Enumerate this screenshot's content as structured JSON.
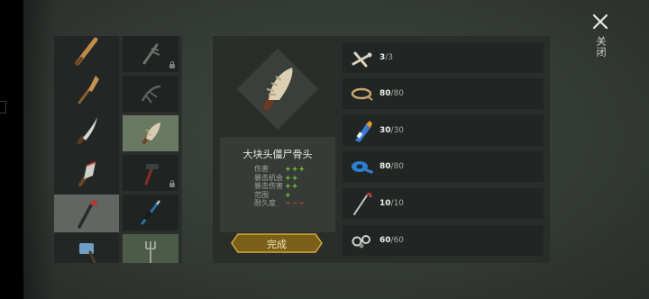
{
  "header": {
    "close_label": "关闭"
  },
  "categories": [
    {
      "icon": "baseball-bat-icon"
    },
    {
      "icon": "wooden-paddle-icon"
    },
    {
      "icon": "machete-icon"
    },
    {
      "icon": "cleaver-icon"
    },
    {
      "icon": "crowbar-icon",
      "selected": true
    },
    {
      "icon": "sledgehammer-icon"
    }
  ],
  "recipes": [
    {
      "icon": "bone-spike-icon",
      "locked": true
    },
    {
      "icon": "bone-claw-icon",
      "locked": false
    },
    {
      "icon": "big-zombie-bone-icon",
      "selected": true
    },
    {
      "icon": "hammer-icon",
      "locked": true
    },
    {
      "icon": "blue-spear-icon",
      "locked": false
    },
    {
      "icon": "fork-icon",
      "locked": false
    }
  ],
  "item": {
    "name": "大块头僵尸骨头",
    "stats": [
      {
        "name": "伤害",
        "value": "+++"
      },
      {
        "name": "暴击机会",
        "value": "++"
      },
      {
        "name": "暴击伤害",
        "value": "++"
      },
      {
        "name": "范围",
        "value": "+"
      },
      {
        "name": "耐久度",
        "value": "−−−"
      }
    ]
  },
  "craft_button": {
    "label": "完成"
  },
  "materials": [
    {
      "icon": "bones-icon",
      "have": "3",
      "need": "/3"
    },
    {
      "icon": "rope-icon",
      "have": "80",
      "need": "/80"
    },
    {
      "icon": "glue-tube-icon",
      "have": "30",
      "need": "/30"
    },
    {
      "icon": "blue-tape-icon",
      "have": "80",
      "need": "/80"
    },
    {
      "icon": "metal-rod-icon",
      "have": "10",
      "need": "/10"
    },
    {
      "icon": "nuts-bolts-icon",
      "have": "60",
      "need": "/60"
    }
  ],
  "colors": {
    "positive": "#7fcf3c",
    "negative": "#d24a3a",
    "accent": "#c9a231"
  }
}
